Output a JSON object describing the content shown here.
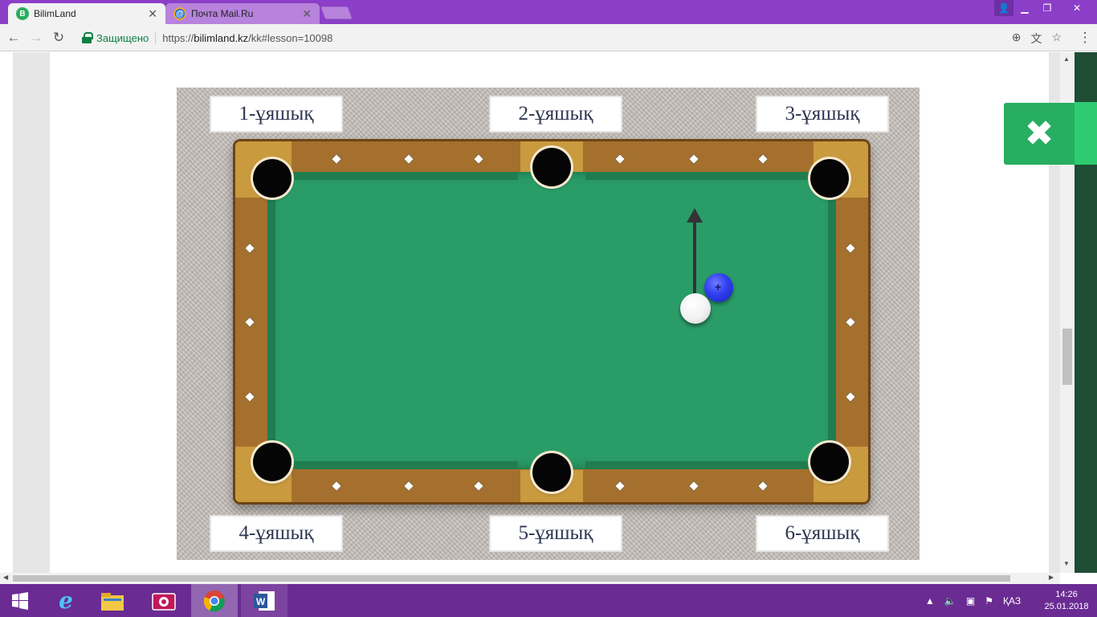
{
  "browser": {
    "tabs": [
      {
        "title": "BilimLand",
        "icon": "bilimland-favicon",
        "active": true
      },
      {
        "title": "Почта Mail.Ru",
        "icon": "mailru-favicon",
        "active": false
      }
    ],
    "secure_label": "Защищено",
    "url_scheme": "https://",
    "url_host": "bilimland.kz",
    "url_path": "/kk#lesson=10098"
  },
  "game": {
    "pockets": [
      "1-ұяшық",
      "2-ұяшық",
      "3-ұяшық",
      "4-ұяшық",
      "5-ұяшық",
      "6-ұяшық"
    ]
  },
  "close_button": {
    "icon": "close-icon"
  },
  "taskbar": {
    "language": "ҚАЗ",
    "time": "14:26",
    "date": "25.01.2018",
    "pinned": [
      "start-button",
      "internet-explorer",
      "file-explorer",
      "camera-app",
      "chrome",
      "word"
    ]
  }
}
